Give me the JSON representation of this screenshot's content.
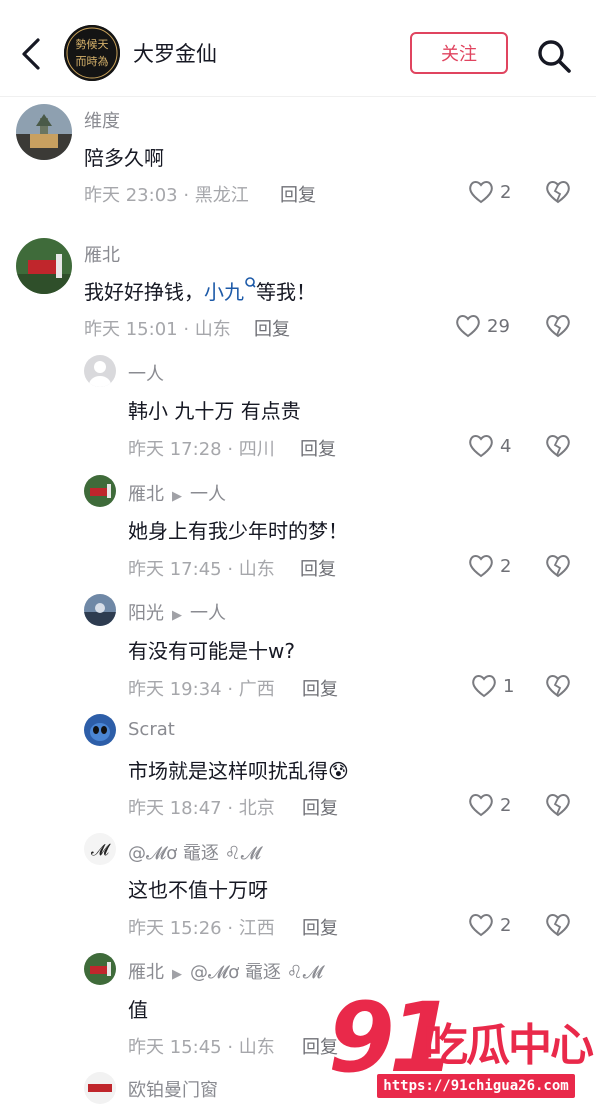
{
  "header": {
    "title": "大罗金仙",
    "follow_label": "关注",
    "avatar_text": "勢候天而時為"
  },
  "comments": [
    {
      "user": "维度",
      "text": "陪多久啊",
      "meta": "昨天 23:03 · 黑龙江",
      "reply": "回复",
      "likes": "2"
    },
    {
      "user": "雁北",
      "text_before": "我好好挣钱，",
      "mention": "小九",
      "text_after": "等我！",
      "meta": "昨天 15:01 · 山东",
      "reply": "回复",
      "likes": "29"
    },
    {
      "user": "一人",
      "text": "韩小  九十万  有点贵",
      "meta": "昨天 17:28 · 四川",
      "reply": "回复",
      "likes": "4"
    },
    {
      "user": "雁北",
      "reply_to": "一人",
      "text": "她身上有我少年时的梦！",
      "meta": "昨天 17:45 · 山东",
      "reply": "回复",
      "likes": "2"
    },
    {
      "user": "阳光",
      "reply_to": "一人",
      "text": "有没有可能是十w?",
      "meta": "昨天 19:34 · 广西",
      "reply": "回复",
      "likes": "1"
    },
    {
      "user": "Scrat",
      "text": "市场就是这样呗扰乱得😰",
      "meta": "昨天 18:47 · 北京",
      "reply": "回复",
      "likes": "2"
    },
    {
      "user": "@𝓜ơ 黿逐 ♌𝓜",
      "text": "这也不值十万呀",
      "meta": "昨天 15:26 · 江西",
      "reply": "回复",
      "likes": "2"
    },
    {
      "user": "雁北",
      "reply_to": "@𝓜ơ 黿逐 ♌𝓜",
      "text": "值",
      "meta": "昨天 15:45 · 山东",
      "reply": "回复"
    },
    {
      "user": "欧铂曼门窗"
    }
  ],
  "watermark": {
    "number": "91",
    "brand": "吃瓜中心",
    "url": "https://91chigua26.com"
  },
  "colors": {
    "accent": "#e0445f",
    "mention": "#1d5aa8",
    "watermark": "#e9294a"
  }
}
